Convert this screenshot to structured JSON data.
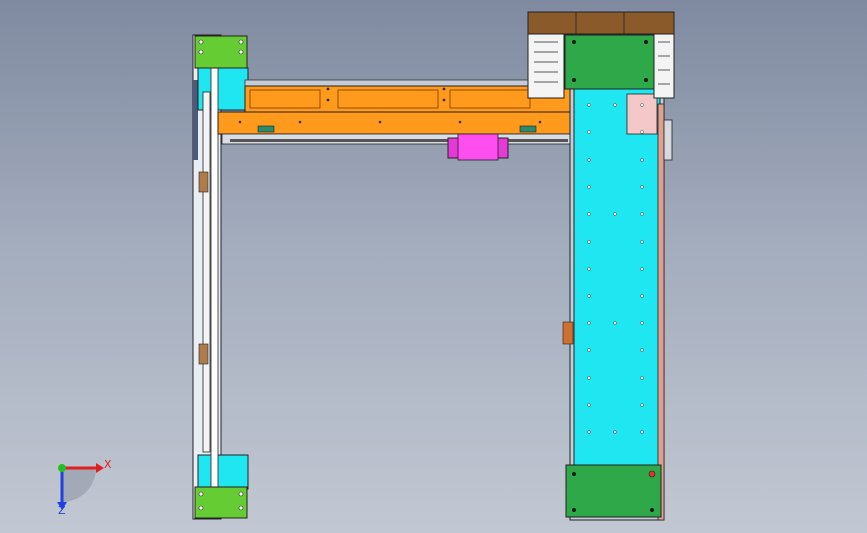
{
  "viewport": {
    "background_top": "#7f8aa0",
    "background_bottom": "#c2c8d3"
  },
  "model": {
    "frame_color": "#333333",
    "plate_cyan": "#1fe6f0",
    "beam_orange": "#ff9a1c",
    "bracket_green": "#66cc33",
    "end_plate_green": "#2fa84a",
    "slider_magenta": "#e63ad8",
    "motor_brown": "#8a5a2a"
  },
  "triad": {
    "x_label": "X",
    "z_label": "Z",
    "x_color": "#e02020",
    "y_color": "#20c020",
    "z_color": "#2040e0"
  }
}
